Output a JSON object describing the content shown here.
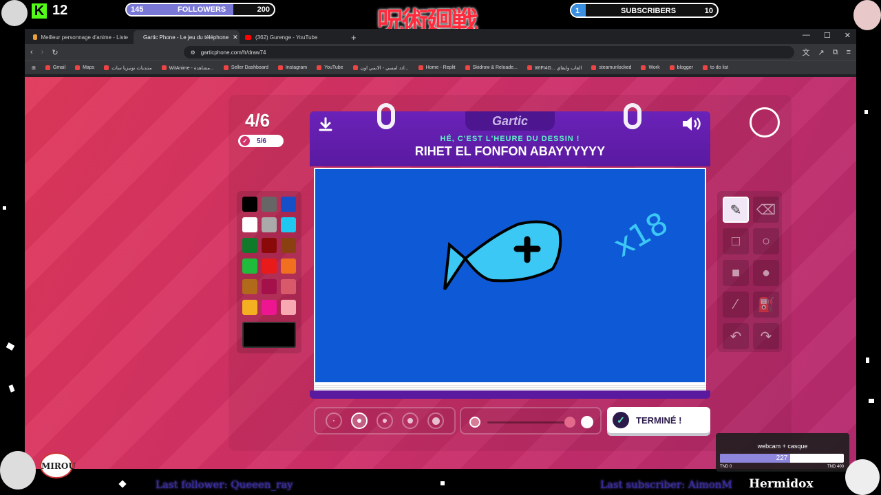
{
  "stream": {
    "kick_count": "12",
    "followers": {
      "current": "145",
      "label": "FOLLOWERS",
      "goal": "200",
      "progress": 0.725
    },
    "subscribers": {
      "current": "1",
      "label": "SUBSCRIBERS",
      "goal": "10",
      "progress": 0.1
    },
    "jp_title": "呪術廻戦",
    "goal_widget": {
      "title": "webcam + casque",
      "value": "227",
      "min": "TND 0",
      "max": "TND 400",
      "progress": 0.5675
    },
    "last_follower": "Last follower: Queeen_ray",
    "last_subscriber": "Last subscriber: AimonM",
    "streamer": "Hermidox",
    "badge": "MIROU"
  },
  "browser": {
    "tabs": [
      {
        "title": "Meilleur personnage d'anime - Liste"
      },
      {
        "title": "Gartic Phone - Le jeu du téléphone"
      },
      {
        "title": "(362) Gurenge - YouTube"
      }
    ],
    "new_tab": "+",
    "url": "garticphone.com/fr/draw74",
    "bookmarks": [
      "Gmail",
      "Maps",
      "منتديات تونيزيا سات",
      "WitAnime - مشاهدة...",
      "Seller Dashboard",
      "Instagram",
      "YouTube",
      "ادد امسي - الانمي اون...",
      "Home - Replit",
      "Skidrow & Reloade...",
      "WIFI4G... العاب وايفاي",
      "steamunlocked",
      "Work",
      "blogger",
      "to do list"
    ]
  },
  "game": {
    "round": "4/6",
    "done_count": "5/6",
    "logo": "Gartic",
    "subtitle": "HÉ, C'EST L'HEURE DU DESSIN !",
    "prompt": "RIHET EL FONFON ABAYYYYYY",
    "done_button": "TERMINÉ !",
    "canvas_note": "x18",
    "palette": [
      "#000000",
      "#666666",
      "#1550c8",
      "#ffffff",
      "#aaaaaa",
      "#1ec8f0",
      "#0f7a2a",
      "#8a0a0a",
      "#8a4010",
      "#1fbb3a",
      "#e81a1a",
      "#f07020",
      "#b06a1a",
      "#a4104a",
      "#d85a6a",
      "#f4b020",
      "#ee1590",
      "#f8a8b0"
    ],
    "current_color": "#000000",
    "canvas_color": "#0e5ad6",
    "fish_color": "#3cc8f4",
    "tools": [
      "pencil-icon",
      "eraser-icon",
      "rectangle-outline-icon",
      "circle-outline-icon",
      "rectangle-filled-icon",
      "circle-filled-icon",
      "line-icon",
      "fill-bucket-icon",
      "undo-icon",
      "redo-icon"
    ]
  }
}
